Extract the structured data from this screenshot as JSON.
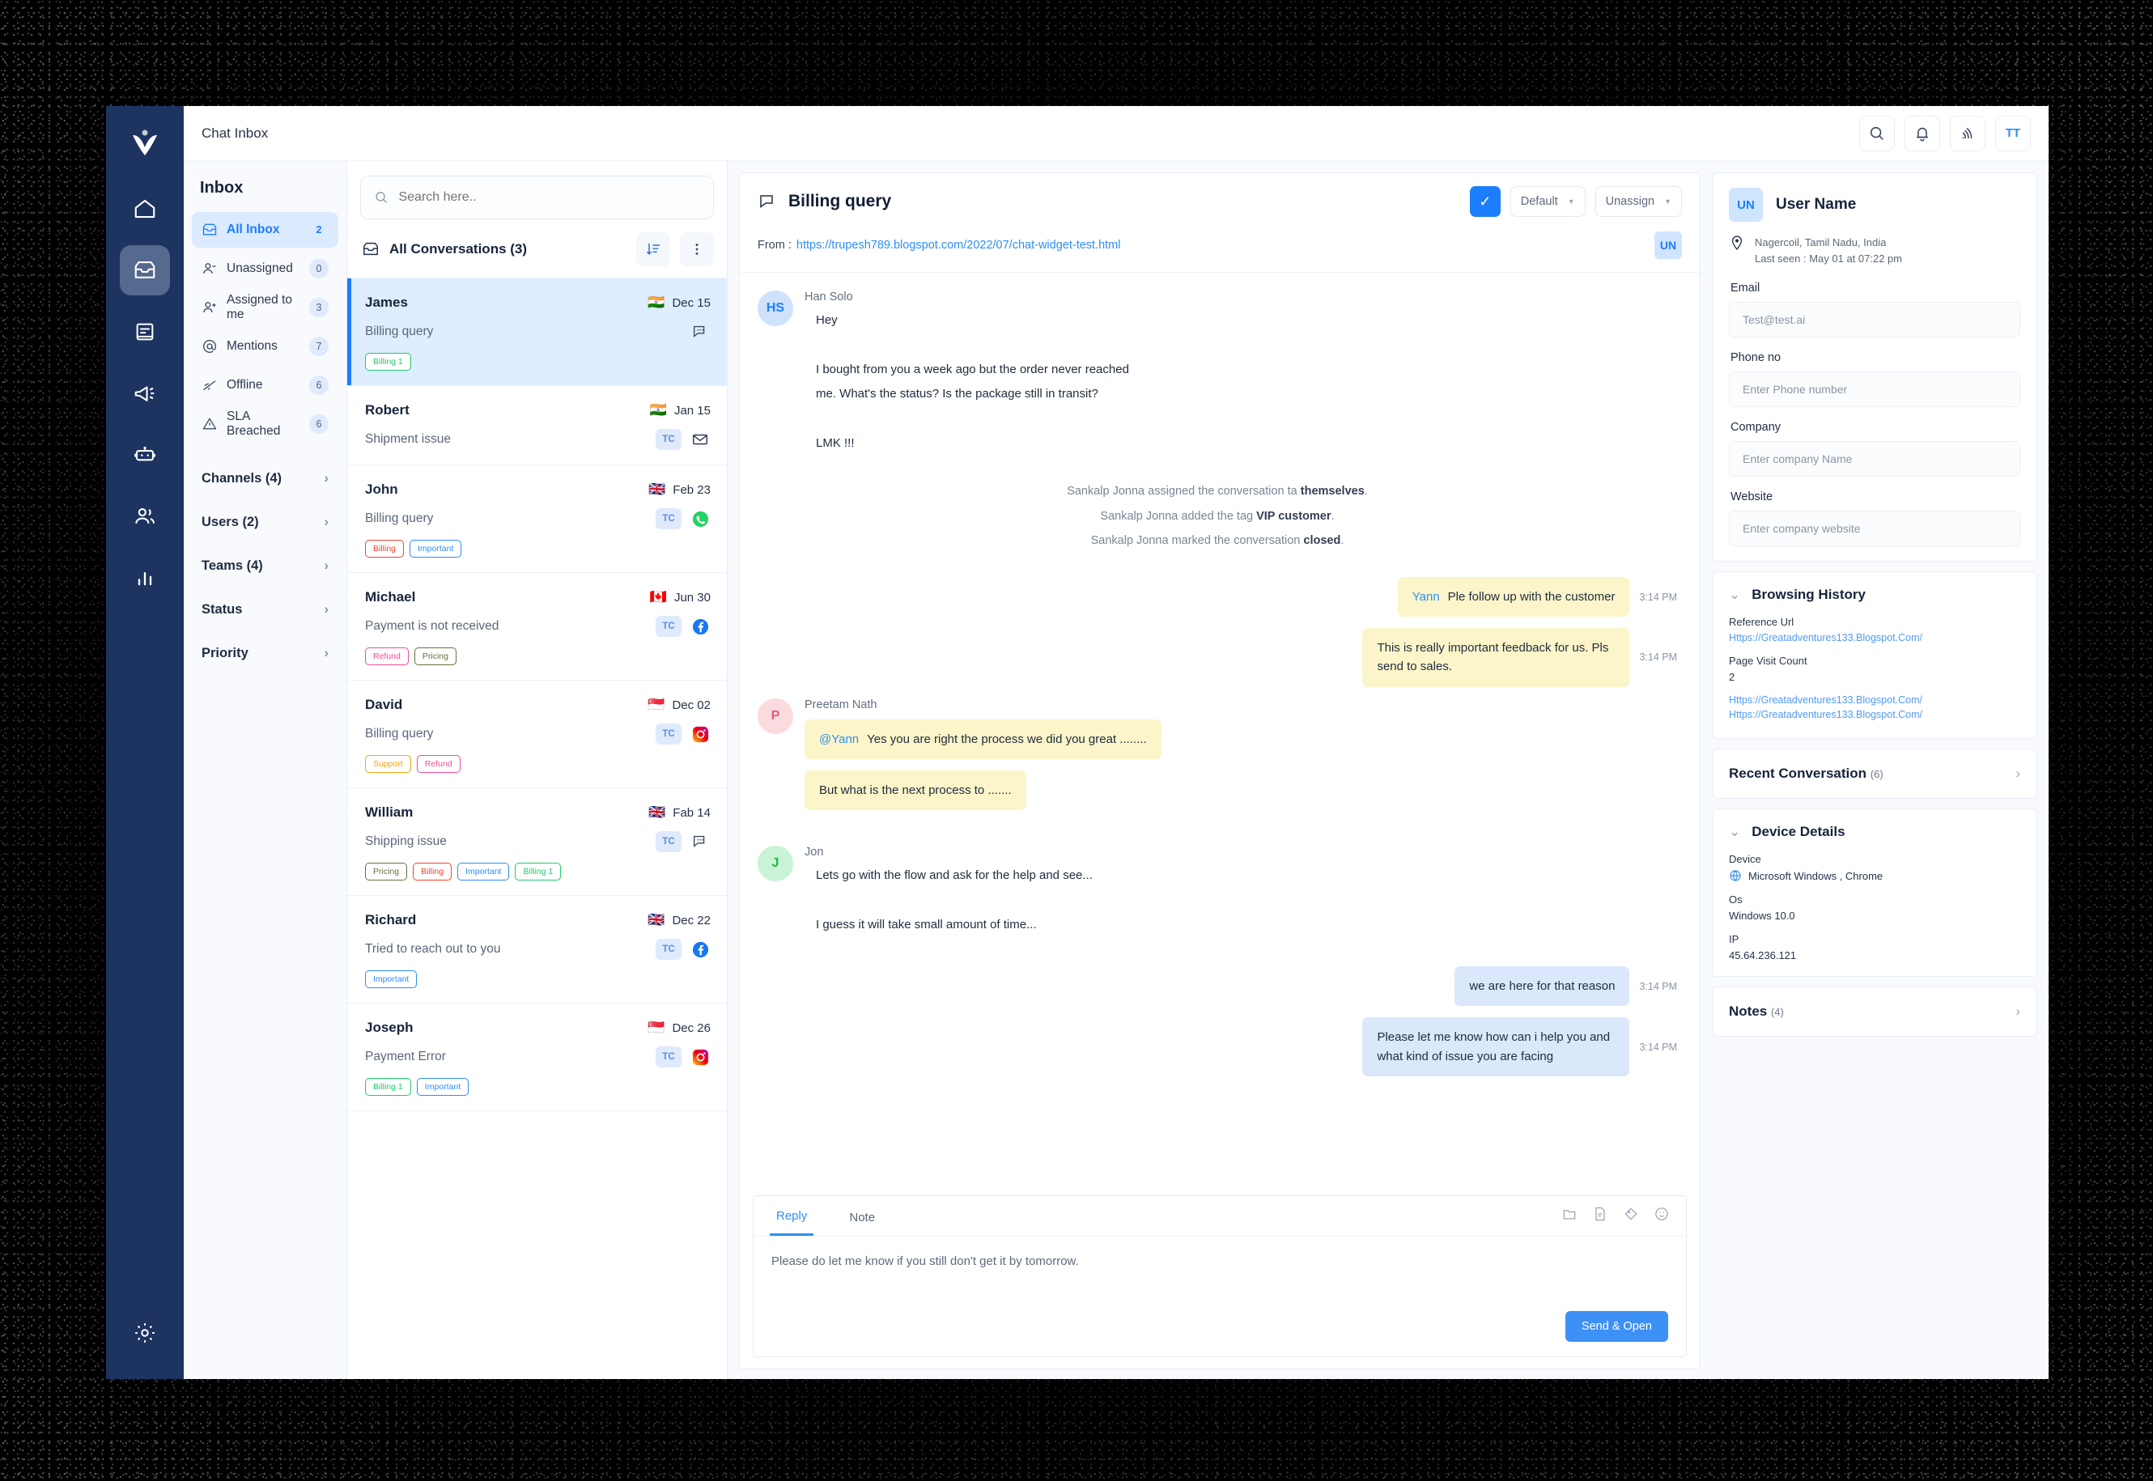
{
  "window": {
    "title": "Chat Inbox"
  },
  "header": {
    "title": "Chat Inbox",
    "actions": [
      {
        "name": "search-icon",
        "label": "Search"
      },
      {
        "name": "bell-icon",
        "label": "Notifications"
      },
      {
        "name": "broadcast-icon",
        "label": "Broadcast"
      }
    ],
    "avatar": "TT"
  },
  "rail": {
    "items": [
      {
        "name": "logo",
        "label": "Verloop"
      },
      {
        "name": "home-icon",
        "label": "Home"
      },
      {
        "name": "inbox-icon",
        "label": "Inbox",
        "active": true
      },
      {
        "name": "book-icon",
        "label": "Knowledge Base"
      },
      {
        "name": "megaphone-icon",
        "label": "Campaigns"
      },
      {
        "name": "robot-icon",
        "label": "Bots"
      },
      {
        "name": "people-icon",
        "label": "Contacts"
      },
      {
        "name": "chart-icon",
        "label": "Analytics"
      },
      {
        "name": "gear-icon",
        "label": "Settings"
      }
    ]
  },
  "sidebar": {
    "title": "Inbox",
    "items": [
      {
        "label": "All Inbox",
        "count": "2",
        "icon": "inbox-icon",
        "active": true
      },
      {
        "label": "Unassigned",
        "count": "0",
        "icon": "user-minus-icon",
        "active": false
      },
      {
        "label": "Assigned to me",
        "count": "3",
        "icon": "user-plus-icon",
        "active": false
      },
      {
        "label": "Mentions",
        "count": "7",
        "icon": "at-icon",
        "active": false
      },
      {
        "label": "Offline",
        "count": "6",
        "icon": "wifi-off-icon",
        "active": false
      },
      {
        "label": "SLA Breached",
        "count": "6",
        "icon": "warning-icon",
        "active": false
      }
    ],
    "sections": [
      {
        "label": "Channels (4)"
      },
      {
        "label": "Users (2)"
      },
      {
        "label": "Teams (4)"
      },
      {
        "label": "Status"
      },
      {
        "label": "Priority"
      }
    ]
  },
  "conversations": {
    "search_placeholder": "Search here..",
    "search_value": "",
    "list_title": "All Conversations (3)",
    "items": [
      {
        "name": "James",
        "date": "Dec 15",
        "flag": "🇮🇳",
        "snippet": "Billing query",
        "channel": "chat-icon",
        "tc": "",
        "selected": true,
        "tags": [
          {
            "label": "Billing 1",
            "color": "#1ecb6b"
          }
        ]
      },
      {
        "name": "Robert",
        "date": "Jan 15",
        "flag": "🇮🇳",
        "snippet": "Shipment issue",
        "channel": "email-icon",
        "tc": "TC",
        "selected": false,
        "tags": []
      },
      {
        "name": "John",
        "date": "Feb 23",
        "flag": "🇬🇧",
        "snippet": "Billing query",
        "channel": "whatsapp-icon",
        "tc": "TC",
        "selected": false,
        "tags": [
          {
            "label": "Billing",
            "color": "#f5422e"
          },
          {
            "label": "Important",
            "color": "#2f8ef5"
          }
        ]
      },
      {
        "name": "Michael",
        "date": "Jun 30",
        "flag": "🇨🇦",
        "snippet": "Payment is not received",
        "channel": "facebook-icon",
        "tc": "TC",
        "selected": false,
        "tags": [
          {
            "label": "Refund",
            "color": "#ef4d9a"
          },
          {
            "label": "Pricing",
            "color": "#6b6f3c"
          }
        ]
      },
      {
        "name": "David",
        "date": "Dec 02",
        "flag": "🇸🇬",
        "snippet": "Billing query",
        "channel": "instagram-icon",
        "tc": "TC",
        "selected": false,
        "tags": [
          {
            "label": "Support",
            "color": "#f3a712"
          },
          {
            "label": "Refund",
            "color": "#ef4d9a"
          }
        ]
      },
      {
        "name": "William",
        "date": "Fab 14",
        "flag": "🇬🇧",
        "snippet": "Shipping issue",
        "channel": "chat-icon",
        "tc": "TC",
        "selected": false,
        "tags": [
          {
            "label": "Pricing",
            "color": "#6b6f3c"
          },
          {
            "label": "Billing",
            "color": "#f5422e"
          },
          {
            "label": "Important",
            "color": "#2f8ef5"
          },
          {
            "label": "Billing 1",
            "color": "#1ecb6b"
          }
        ]
      },
      {
        "name": "Richard",
        "date": "Dec 22",
        "flag": "🇬🇧",
        "snippet": "Tried to reach out to you",
        "channel": "facebook-icon",
        "tc": "TC",
        "selected": false,
        "tags": [
          {
            "label": "Important",
            "color": "#2f8ef5"
          }
        ]
      },
      {
        "name": "Joseph",
        "date": "Dec 26",
        "flag": "🇸🇬",
        "snippet": "Payment Error",
        "channel": "instagram-icon",
        "tc": "TC",
        "selected": false,
        "tags": [
          {
            "label": "Billing 1",
            "color": "#1ecb6b"
          },
          {
            "label": "Important",
            "color": "#2f8ef5"
          }
        ]
      }
    ]
  },
  "chat": {
    "title": "Billing query",
    "resolve_checked": true,
    "priority_select": "Default",
    "assign_select": "Unassign",
    "from_label": "From :",
    "from_url": "https://trupesh789.blogspot.com/2022/07/chat-widget-test.html",
    "assignee_initials": "UN",
    "messages": [
      {
        "type": "incoming",
        "sender": "Han Solo",
        "avatar": "HS",
        "avatar_style": "hs",
        "lines": [
          "Hey",
          "I bought from you a week ago but the order never reached",
          "me. What's the status? Is the package still in transit?",
          "LMK !!!"
        ]
      },
      {
        "type": "system",
        "text_pre": "Sankalp Jonna assigned the conversation ta ",
        "text_bold": "themselves",
        "text_post": "."
      },
      {
        "type": "system",
        "text_pre": "Sankalp Jonna added the tag ",
        "text_bold": "VIP customer",
        "text_post": "."
      },
      {
        "type": "system",
        "text_pre": "Sankalp Jonna marked the conversation ",
        "text_bold": "closed",
        "text_post": "."
      },
      {
        "type": "note-right",
        "mention": "Yann",
        "text": "Ple follow up with the customer",
        "time": "3:14 PM"
      },
      {
        "type": "note-right",
        "mention": "",
        "text": "This is really important feedback for us. Pls send to sales.",
        "time": "3:14 PM"
      },
      {
        "type": "note-left",
        "sender": "Preetam Nath",
        "avatar": "P",
        "avatar_style": "p",
        "mention": "@Yann",
        "text": "Yes you are right the process we did you great ........",
        "time": ""
      },
      {
        "type": "note-left-cont",
        "mention": "",
        "text": "But what is the next process to .......",
        "time": ""
      },
      {
        "type": "incoming",
        "sender": "Jon",
        "avatar": "J",
        "avatar_style": "j",
        "lines": [
          "Lets go with the flow and ask for the help and see...",
          "I guess it will take small amount of time..."
        ]
      },
      {
        "type": "outgoing",
        "text": "we are here for that reason",
        "time": "3:14 PM"
      },
      {
        "type": "outgoing",
        "text": "Please let me know how can i help you and what kind of issue you are facing",
        "time": "3:14 PM"
      }
    ],
    "composer": {
      "tabs": [
        {
          "label": "Reply",
          "active": true
        },
        {
          "label": "Note",
          "active": false
        }
      ],
      "tools": [
        "folder-icon",
        "template-icon",
        "tag-icon",
        "emoji-icon"
      ],
      "text": "Please do let me know if you still don't get it by tomorrow.",
      "send_label": "Send & Open"
    }
  },
  "contact": {
    "initials": "UN",
    "name": "User Name",
    "location": "Nagercoil, Tamil Nadu, India",
    "last_seen": "Last seen : May 01 at 07:22 pm",
    "fields": [
      {
        "label": "Email",
        "value": "Test@test.ai",
        "placeholder": "Test@test.ai"
      },
      {
        "label": "Phone no",
        "value": "",
        "placeholder": "Enter Phone number"
      },
      {
        "label": "Company",
        "value": "",
        "placeholder": "Enter company Name"
      },
      {
        "label": "Website",
        "value": "",
        "placeholder": "Enter company website"
      }
    ],
    "browsing_history": {
      "title": "Browsing History",
      "reference_url_label": "Reference Url",
      "reference_url": "Https://Greatadventures133.Blogspot.Com/",
      "page_visit_count_label": "Page Visit Count",
      "page_visit_count": "2",
      "urls": [
        "Https://Greatadventures133.Blogspot.Com/",
        "Https://Greatadventures133.Blogspot.Com/"
      ]
    },
    "recent_conversation": {
      "title": "Recent Conversation",
      "count": "(6)"
    },
    "device_details": {
      "title": "Device Details",
      "device_label": "Device",
      "device_value": "Microsoft Windows , Chrome",
      "os_label": "Os",
      "os_value": "Windows 10.0",
      "ip_label": "IP",
      "ip_value": "45.64.236.121"
    },
    "notes": {
      "title": "Notes",
      "count": "(4)"
    }
  }
}
